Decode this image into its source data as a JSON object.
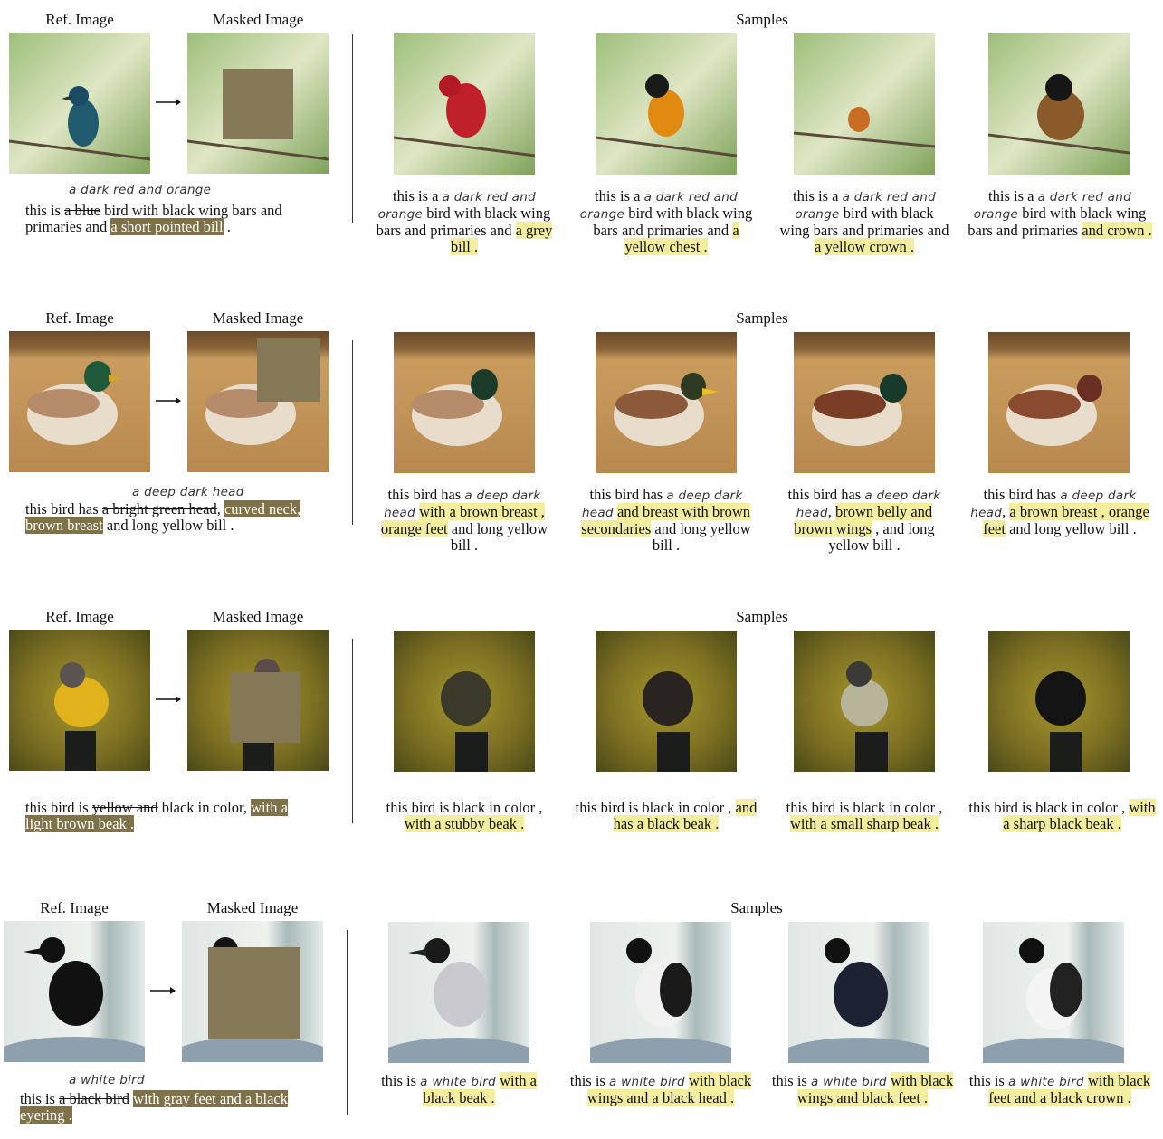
{
  "colors": {
    "mask": "#847857",
    "highlight_yellow": "#f3ee9f",
    "highlight_brown": "#7f7148"
  },
  "labels": {
    "ref": "Ref. Image",
    "masked": "Masked Image",
    "samples": "Samples"
  },
  "rows": [
    {
      "edit": "a dark red and orange",
      "ref": {
        "pre": "this is",
        "strike": "a blue",
        "mid": "bird with black wing bars and primaries and",
        "hl": "a short pointed bill",
        "post": "."
      },
      "samples": [
        {
          "pre": "this is a",
          "edit": "a dark red and orange",
          "mid": "bird with black wing bars and primaries and",
          "hl": "a grey bill ."
        },
        {
          "pre": "this is a",
          "edit": "a dark red and orange",
          "mid": "bird with black wing bars and primaries and",
          "hl": "a yellow chest ."
        },
        {
          "pre": "this is a",
          "edit": "a dark red and orange",
          "mid": "bird with black wing bars and primaries and",
          "hl": "a yellow crown ."
        },
        {
          "pre": "this is a",
          "edit": "a dark red and orange",
          "mid": "bird with black wing bars and primaries",
          "hl": "and crown ."
        }
      ]
    },
    {
      "edit": "a deep dark head",
      "ref": {
        "pre": "this bird has",
        "strike": "a bright green head",
        "mid": ",",
        "hl": "curved neck, brown breast",
        "post": "and long yellow bill ."
      },
      "samples": [
        {
          "pre": "this bird has",
          "edit": "a deep dark head",
          "hl": "with a brown breast , orange feet",
          "post": "and long yellow bill ."
        },
        {
          "pre": "this bird has",
          "edit": "a deep dark head",
          "hl": "and breast with brown secondaries",
          "post": "and long yellow bill ."
        },
        {
          "pre": "this bird has",
          "edit": "a deep dark head",
          "mid": ",",
          "hl": "brown belly and brown wings",
          "post": ", and long yellow bill ."
        },
        {
          "pre": "this bird has",
          "edit": "a deep dark head",
          "mid": ",",
          "hl": "a brown breast , orange feet",
          "post": "and long yellow bill ."
        }
      ]
    },
    {
      "ref": {
        "pre": "this bird is",
        "strike": "yellow and",
        "mid": "black in color,",
        "hl": "with a light brown beak .",
        "post": ""
      },
      "samples": [
        {
          "pre": "this bird is black in color ,",
          "hl": "with a stubby beak ."
        },
        {
          "pre": "this bird is black in color ,",
          "hl": "and has a black beak ."
        },
        {
          "pre": "this bird is black in color ,",
          "hl": "with a small sharp beak ."
        },
        {
          "pre": "this bird is black in color ,",
          "hl": "with a sharp black beak ."
        }
      ]
    },
    {
      "edit": "a white bird",
      "ref": {
        "pre": "this is",
        "strike": "a black bird",
        "hl": "with gray feet and a black eyering .",
        "post": ""
      },
      "samples": [
        {
          "pre": "this is",
          "edit": "a white bird",
          "hl": "with a black beak ."
        },
        {
          "pre": "this is",
          "edit": "a white bird",
          "hl": "with black wings and a black head ."
        },
        {
          "pre": "this is",
          "edit": "a white bird",
          "hl": "with black wings and black feet ."
        },
        {
          "pre": "this is",
          "edit": "a white bird",
          "hl": "with black feet and a black crown ."
        }
      ]
    }
  ]
}
